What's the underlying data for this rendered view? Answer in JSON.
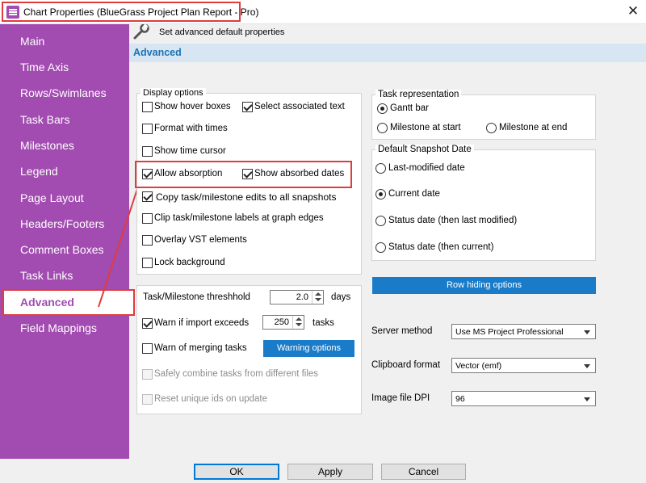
{
  "window": {
    "title": "Chart Properties (BlueGrass Project Plan Report - Pro)",
    "close_glyph": "✕"
  },
  "sidebar": {
    "items": [
      {
        "label": "Main"
      },
      {
        "label": "Time Axis"
      },
      {
        "label": "Rows/Swimlanes"
      },
      {
        "label": "Task Bars"
      },
      {
        "label": "Milestones"
      },
      {
        "label": "Legend"
      },
      {
        "label": "Page Layout"
      },
      {
        "label": "Headers/Footers"
      },
      {
        "label": "Comment Boxes"
      },
      {
        "label": "Task Links"
      },
      {
        "label": "Advanced",
        "active": true
      },
      {
        "label": "Field Mappings"
      }
    ]
  },
  "header": {
    "description": "Set advanced default properties",
    "section_title": "Advanced",
    "icon": "wrench-icon"
  },
  "display_options": {
    "legend": "Display options",
    "show_hover_boxes": {
      "label": "Show hover boxes",
      "checked": false
    },
    "select_associated_text": {
      "label": "Select associated text",
      "checked": true
    },
    "format_with_times": {
      "label": "Format with times",
      "checked": false
    },
    "show_time_cursor": {
      "label": "Show time cursor",
      "checked": false
    },
    "allow_absorption": {
      "label": "Allow absorption",
      "checked": true
    },
    "show_absorbed_dates": {
      "label": "Show absorbed dates",
      "checked": true
    },
    "copy_edits": {
      "label": "Copy task/milestone edits to all snapshots",
      "checked": true
    },
    "clip_labels": {
      "label": "Clip task/milestone labels at graph edges",
      "checked": false
    },
    "overlay_vst": {
      "label": "Overlay VST elements",
      "checked": false
    },
    "lock_background": {
      "label": "Lock background",
      "checked": false
    }
  },
  "import_options": {
    "threshold_label": "Task/Milestone threshhold",
    "threshold_value": "2.0",
    "threshold_unit": "days",
    "warn_import": {
      "label": "Warn if import exceeds",
      "checked": true
    },
    "warn_import_value": "250",
    "warn_import_unit": "tasks",
    "warn_merging": {
      "label": "Warn of merging tasks",
      "checked": false
    },
    "warning_options_button": "Warning options",
    "safely_combine": {
      "label": "Safely combine tasks from different files",
      "checked": false
    },
    "reset_ids": {
      "label": "Reset unique ids on update",
      "checked": false
    }
  },
  "task_representation": {
    "legend": "Task representation",
    "gantt_bar": {
      "label": "Gantt bar",
      "selected": true
    },
    "milestone_at_start": {
      "label": "Milestone at start",
      "selected": false
    },
    "milestone_at_end": {
      "label": "Milestone at end",
      "selected": false
    }
  },
  "snapshot_date": {
    "legend": "Default Snapshot Date",
    "last_modified": {
      "label": "Last-modified date",
      "selected": false
    },
    "current_date": {
      "label": "Current date",
      "selected": true
    },
    "status_then_last": {
      "label": "Status date (then last modified)",
      "selected": false
    },
    "status_then_current": {
      "label": "Status date (then current)",
      "selected": false
    }
  },
  "row_hiding_button": "Row hiding options",
  "server_method": {
    "label": "Server method",
    "value": "Use MS Project Professional"
  },
  "clipboard_format": {
    "label": "Clipboard format",
    "value": "Vector (emf)"
  },
  "image_dpi": {
    "label": "Image file DPI",
    "value": "96"
  },
  "buttons": {
    "ok": "OK",
    "apply": "Apply",
    "cancel": "Cancel"
  },
  "colors": {
    "sidebar_bg": "#a24bb0",
    "accent_blue": "#1a7cc9",
    "highlight_red": "#e03c3c",
    "section_title": "#1a73b5"
  }
}
